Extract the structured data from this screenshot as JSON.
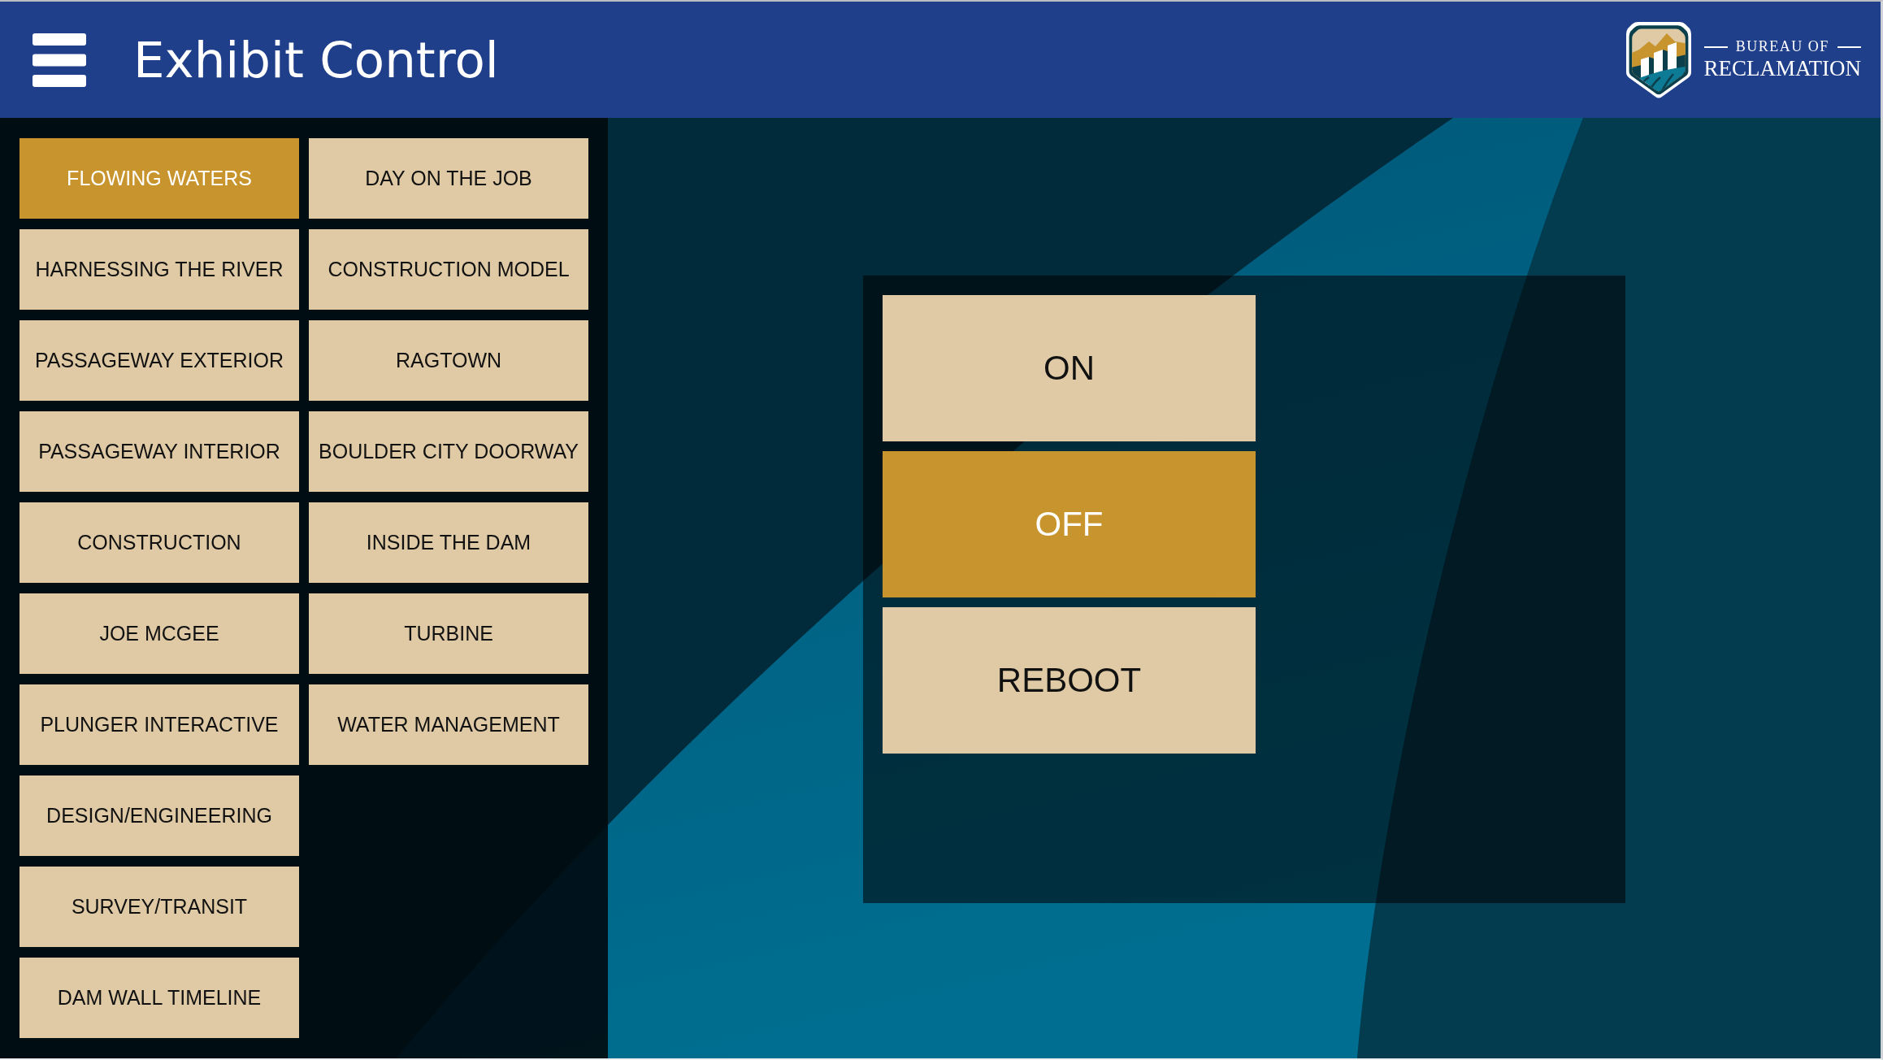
{
  "header": {
    "title": "Exhibit Control",
    "logo": {
      "line_1": "BUREAU OF",
      "line_2": "RECLAMATION"
    }
  },
  "exhibit_columns": [
    {
      "items": [
        {
          "label": "FLOWING WATERS",
          "selected": true
        },
        {
          "label": "HARNESSING THE RIVER",
          "selected": false
        },
        {
          "label": "PASSAGEWAY EXTERIOR",
          "selected": false
        },
        {
          "label": "PASSAGEWAY INTERIOR",
          "selected": false
        },
        {
          "label": "CONSTRUCTION",
          "selected": false
        },
        {
          "label": "JOE MCGEE",
          "selected": false
        },
        {
          "label": "PLUNGER INTERACTIVE",
          "selected": false
        },
        {
          "label": "DESIGN/ENGINEERING",
          "selected": false
        },
        {
          "label": "SURVEY/TRANSIT",
          "selected": false
        },
        {
          "label": "DAM WALL TIMELINE",
          "selected": false
        }
      ]
    },
    {
      "items": [
        {
          "label": "DAY ON THE JOB",
          "selected": false
        },
        {
          "label": "CONSTRUCTION MODEL",
          "selected": false
        },
        {
          "label": "RAGTOWN",
          "selected": false
        },
        {
          "label": "BOULDER CITY DOORWAY",
          "selected": false
        },
        {
          "label": "INSIDE THE DAM",
          "selected": false
        },
        {
          "label": "TURBINE",
          "selected": false
        },
        {
          "label": "WATER MANAGEMENT",
          "selected": false
        }
      ]
    }
  ],
  "power_controls": [
    {
      "label": "ON",
      "selected": false
    },
    {
      "label": "OFF",
      "selected": true
    },
    {
      "label": "REBOOT",
      "selected": false
    }
  ]
}
